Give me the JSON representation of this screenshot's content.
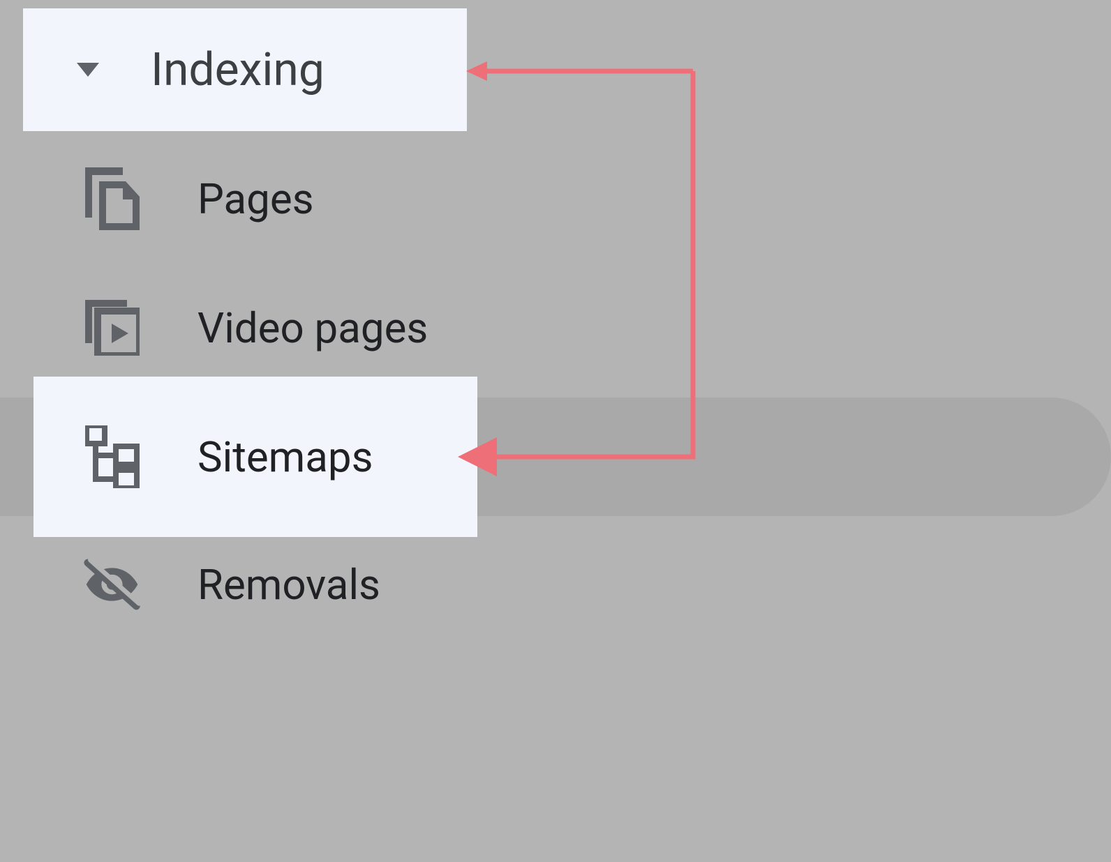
{
  "sidebar": {
    "section_header": "Indexing",
    "items": {
      "pages": "Pages",
      "video_pages": "Video pages",
      "sitemaps": "Sitemaps",
      "removals": "Removals"
    }
  },
  "colors": {
    "highlight_bg": "#f2f6fc",
    "page_bg": "#b4b4b4",
    "text_primary": "#202124",
    "text_secondary": "#3c4043",
    "icon": "#5f6368",
    "arrow": "#ef6f78"
  }
}
